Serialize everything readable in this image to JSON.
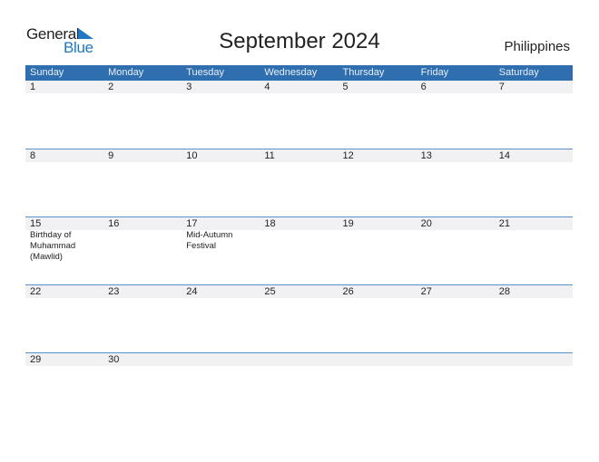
{
  "logo": {
    "line1": "General",
    "line2": "Blue"
  },
  "title": "September 2024",
  "country": "Philippines",
  "colors": {
    "header_bg": "#2f6faf",
    "accent": "#1f78c1",
    "row_band": "#f1f1f3"
  },
  "weekdays": [
    "Sunday",
    "Monday",
    "Tuesday",
    "Wednesday",
    "Thursday",
    "Friday",
    "Saturday"
  ],
  "weeks": [
    [
      {
        "day": "1",
        "event": ""
      },
      {
        "day": "2",
        "event": ""
      },
      {
        "day": "3",
        "event": ""
      },
      {
        "day": "4",
        "event": ""
      },
      {
        "day": "5",
        "event": ""
      },
      {
        "day": "6",
        "event": ""
      },
      {
        "day": "7",
        "event": ""
      }
    ],
    [
      {
        "day": "8",
        "event": ""
      },
      {
        "day": "9",
        "event": ""
      },
      {
        "day": "10",
        "event": ""
      },
      {
        "day": "11",
        "event": ""
      },
      {
        "day": "12",
        "event": ""
      },
      {
        "day": "13",
        "event": ""
      },
      {
        "day": "14",
        "event": ""
      }
    ],
    [
      {
        "day": "15",
        "event": "Birthday of Muhammad (Mawlid)"
      },
      {
        "day": "16",
        "event": ""
      },
      {
        "day": "17",
        "event": "Mid-Autumn Festival"
      },
      {
        "day": "18",
        "event": ""
      },
      {
        "day": "19",
        "event": ""
      },
      {
        "day": "20",
        "event": ""
      },
      {
        "day": "21",
        "event": ""
      }
    ],
    [
      {
        "day": "22",
        "event": ""
      },
      {
        "day": "23",
        "event": ""
      },
      {
        "day": "24",
        "event": ""
      },
      {
        "day": "25",
        "event": ""
      },
      {
        "day": "26",
        "event": ""
      },
      {
        "day": "27",
        "event": ""
      },
      {
        "day": "28",
        "event": ""
      }
    ],
    [
      {
        "day": "29",
        "event": ""
      },
      {
        "day": "30",
        "event": ""
      },
      {
        "day": "",
        "event": ""
      },
      {
        "day": "",
        "event": ""
      },
      {
        "day": "",
        "event": ""
      },
      {
        "day": "",
        "event": ""
      },
      {
        "day": "",
        "event": ""
      }
    ]
  ]
}
